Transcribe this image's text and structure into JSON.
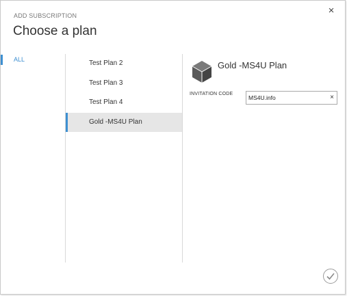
{
  "dialog": {
    "subtitle": "ADD SUBSCRIPTION",
    "title": "Choose a plan",
    "close_icon": "close-icon",
    "close_glyph": "×"
  },
  "filters": [
    {
      "label": "ALL",
      "selected": true
    }
  ],
  "plans": [
    {
      "label": "Test Plan 2",
      "selected": false
    },
    {
      "label": "Test Plan 3",
      "selected": false
    },
    {
      "label": "Test Plan 4",
      "selected": false
    },
    {
      "label": "Gold -MS4U Plan",
      "selected": true
    }
  ],
  "detail": {
    "icon": "cube-icon",
    "title": "Gold -MS4U Plan",
    "invitation_label": "INVITATION CODE",
    "invitation_value": "MS4U.info",
    "clear_icon": "clear-icon",
    "clear_glyph": "×"
  },
  "footer": {
    "confirm_icon": "checkmark-icon"
  },
  "colors": {
    "accent": "#3d8fd1",
    "selected_bg": "#e6e6e6",
    "icon_gray": "#5a5a5a"
  }
}
